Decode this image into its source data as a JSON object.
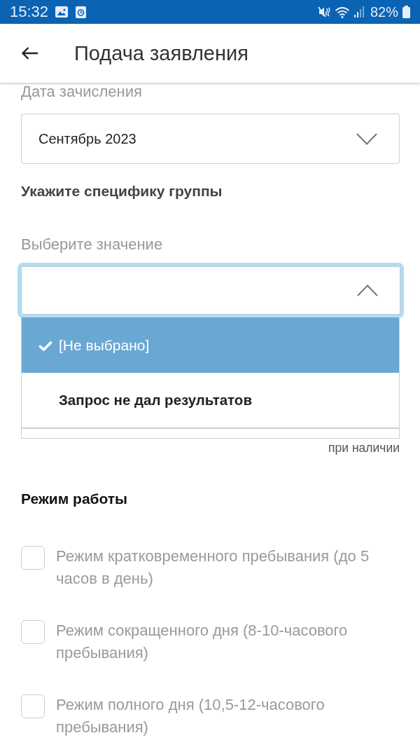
{
  "status_bar": {
    "time": "15:32",
    "battery": "82%"
  },
  "app_bar": {
    "title": "Подача заявления"
  },
  "enrollment_date": {
    "label": "Дата зачисления",
    "value": "Сентябрь 2023",
    "expanded": false
  },
  "group_specifics": {
    "heading": "Укажите специфику группы",
    "label": "Выберите значение",
    "expanded": true,
    "options": [
      {
        "kind": "option",
        "label": "[Не выбрано]",
        "selected": true
      },
      {
        "kind": "message",
        "label": "Запрос не дал результатов",
        "selected": false
      }
    ]
  },
  "extra_field": {
    "hint": "при наличии"
  },
  "work_mode": {
    "heading": "Режим работы",
    "options": [
      {
        "label": "Режим кратковременного пребывания (до 5 часов в день)",
        "checked": false
      },
      {
        "label": "Режим сокращенного дня (8-10-часового пребывания)",
        "checked": false
      },
      {
        "label": "Режим полного дня (10,5-12-часового пребывания)",
        "checked": false
      }
    ]
  }
}
